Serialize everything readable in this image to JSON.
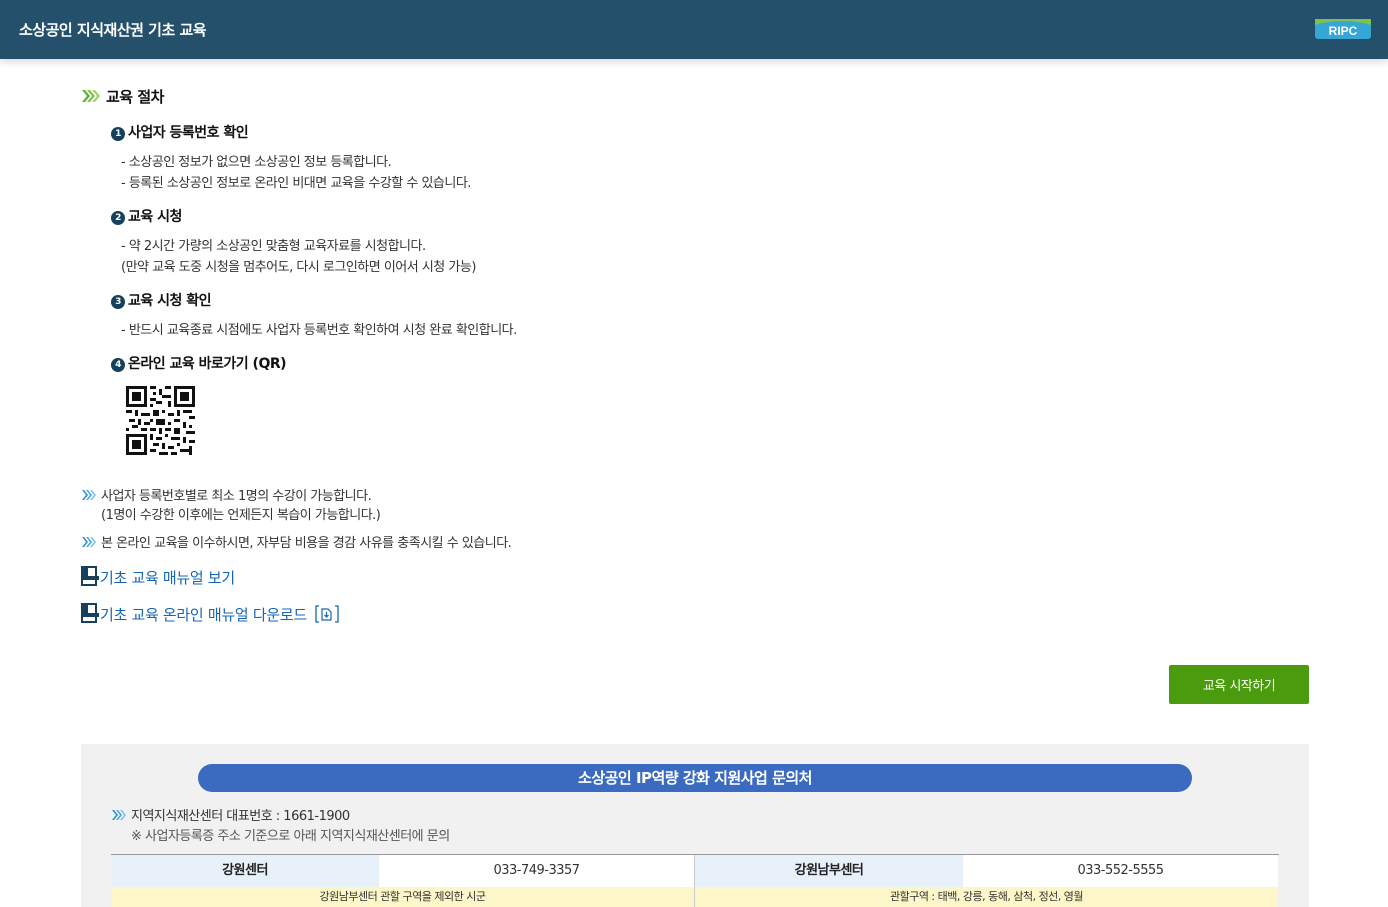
{
  "header": {
    "title": "소상공인 지식재산권 기초 교육",
    "logo_text": "RIPC"
  },
  "procedure": {
    "title": "교육 절차",
    "steps": [
      {
        "num": "1",
        "title": "사업자 등록번호 확인",
        "lines": [
          "- 소상공인 정보가 없으면 소상공인 정보 등록합니다.",
          "- 등록된 소상공인 정보로 온라인 비대면 교육을 수강할 수 있습니다."
        ]
      },
      {
        "num": "2",
        "title": "교육 시청",
        "lines": [
          "- 약 2시간 가량의 소상공인 맞춤형 교육자료를 시청합니다.",
          "(만약 교육 도중 시청을 멈추어도, 다시 로그인하면 이어서 시청 가능)"
        ]
      },
      {
        "num": "3",
        "title": "교육 시청 확인",
        "lines": [
          "- 반드시 교육종료 시점에도 사업자 등록번호 확인하여 시청 완료 확인합니다."
        ]
      },
      {
        "num": "4",
        "title": "온라인 교육 바로가기 (QR)",
        "lines": []
      }
    ]
  },
  "notes": [
    {
      "line1": "사업자 등록번호별로 최소 1명의 수강이 가능합니다.",
      "line2": "(1명이 수강한 이후에는 언제든지 복습이 가능합니다.)"
    },
    {
      "line1": "본 온라인 교육을 이수하시면, 자부담 비용을 경감 사유를 충족시킬 수 있습니다."
    }
  ],
  "links": {
    "manual_view": "기초 교육 매뉴얼 보기",
    "manual_download": "기초 교육 온라인 매뉴얼 다운로드"
  },
  "start_button": "교육 시작하기",
  "contact": {
    "title": "소상공인 IP역량 강화 지원사업 문의처",
    "main_line": "지역지식재산센터 대표번호 : 1661-1900",
    "note_line": "※ 사업자등록증 주소 기준으로 아래 지역지식재산센터에 문의",
    "centers": [
      {
        "name": "강원센터",
        "phone": "033-749-3357",
        "area": "강원남부센터 관할 구역을 제외한 시군"
      },
      {
        "name": "강원남부센터",
        "phone": "033-552-5555",
        "area": "관할구역 : 태백, 강릉, 동해, 삼척, 정선, 영월"
      }
    ]
  },
  "colors": {
    "header_bg": "#24506c",
    "accent_green": "#4a9b0e",
    "link_blue": "#1566b8",
    "contact_title_bg": "#3b6bc0"
  },
  "icons": [
    "triple-chevron-icon",
    "document-link-icon",
    "download-icon",
    "qr-code-image"
  ]
}
